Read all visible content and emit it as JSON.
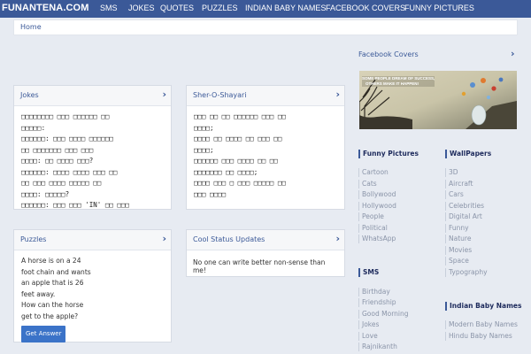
{
  "brand": "FUNANTENA.COM",
  "nav": [
    "SMS",
    "JOKES",
    "QUOTES",
    "PUZZLES",
    "INDIAN BABY NAMES",
    "FACEBOOK COVERS",
    "FUNNY PICTURES"
  ],
  "breadcrumb": "Home",
  "jokes": {
    "title": "Jokes",
    "lines": [
      "□□□□□□□□ □□□ □□□□□□ □□",
      "□□□□□:",
      "□□□□□□: □□□ □□□□ □□□□□□",
      "□□ □□□□□□□ □□□ □□□",
      "□□□□: □□ □□□□ □□□?",
      "□□□□□□: □□□□ □□□□ □□□ □□",
      "□□ □□□ □□□□ □□□□□ □□",
      "□□□□: □□□□□?",
      "□□□□□□: □□□ □□□ 'IN' □□ □□□"
    ]
  },
  "shayari": {
    "title": "Sher-O-Shayari",
    "lines": [
      "□□□ □□ □□ □□□□□□ □□□ □□",
      "□□□□;",
      "□□□□ □□ □□□□ □□ □□□ □□",
      "□□□□;",
      "□□□□□□ □□□ □□□□ □□ □□",
      "□□□□□□□ □□ □□□□;",
      "□□□□ □□□ □ □□□ □□□□□ □□",
      "□□□ □□□□"
    ]
  },
  "puzzles": {
    "title": "Puzzles",
    "lines": [
      "A horse is on a 24",
      "foot chain and wants",
      "an apple that is 26",
      "feet away.",
      "How can the horse",
      "get to the apple?"
    ],
    "button": "Get Answer"
  },
  "status": {
    "title": "Cool Status Updates",
    "text": "No one can write better non-sense than me!"
  },
  "sidebar": {
    "fb_title": "Facebook Covers",
    "cover_text_1": "SOME PEOPLE DREAM OF SUCCESS,",
    "cover_text_2": "OTHERS MAKE IT HAPPEN!",
    "funny_title": "Funny Pictures",
    "funny": [
      "Cartoon",
      "Cats",
      "Bollywood",
      "Hollywood",
      "People",
      "Political",
      "WhatsApp"
    ],
    "wall_title": "WallPapers",
    "wall": [
      "3D",
      "Aircraft",
      "Cars",
      "Celebrities",
      "Digital Art",
      "Funny",
      "Nature",
      "Movies",
      "Space",
      "Typography"
    ],
    "sms_title": "SMS",
    "sms": [
      "Birthday",
      "Friendship",
      "Good Morning",
      "Jokes",
      "Love",
      "Rajnikanth"
    ],
    "baby_title": "Indian Baby Names",
    "baby": [
      "Modern Baby Names",
      "Hindu Baby Names"
    ]
  },
  "chevron": "›"
}
